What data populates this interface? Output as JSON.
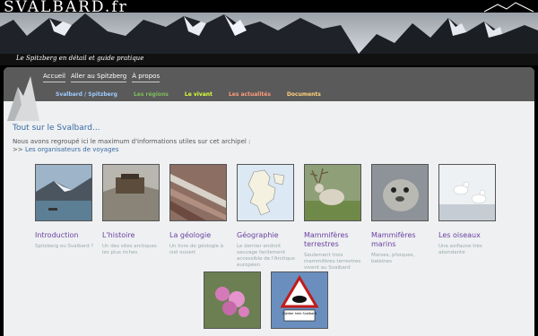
{
  "site": {
    "logo": "SVALBARD.fr",
    "tagline": "Le Spitzberg en détail et guide pratique"
  },
  "nav": {
    "top": [
      "Accueil",
      "Aller au Spitzberg",
      "À propos"
    ],
    "sub": [
      {
        "label": "Svalbard / Spitzberg",
        "color": "#9ecbff"
      },
      {
        "label": "Les régions",
        "color": "#7fbf5a"
      },
      {
        "label": "Le vivant",
        "color": "#d8ff3a"
      },
      {
        "label": "Les actualités",
        "color": "#ff9c7a"
      },
      {
        "label": "Documents",
        "color": "#ffd27a"
      }
    ]
  },
  "main": {
    "heading": "Tout sur le Svalbard...",
    "intro": "Nous avons regroupé ici le maximum d'informations utiles sur cet archipel :",
    "arrow": ">>",
    "link": "Les organisateurs de voyages"
  },
  "cards": [
    {
      "title": "Introduction",
      "desc": "Spitzberg ou Svalbard ?",
      "icon": "glacier-photo"
    },
    {
      "title": "L'histoire",
      "desc": "Un des sites arctiques les plus riches",
      "icon": "hut-photo"
    },
    {
      "title": "La géologie",
      "desc": "Un livre de géologie à ciel ouvert",
      "icon": "rock-strata-photo"
    },
    {
      "title": "Géographie",
      "desc": "Le dernier endroit sauvage facilement accessible de l'Arctique européen",
      "icon": "map"
    },
    {
      "title": "Mammifères terrestres",
      "desc": "Seulement trois mammifères terrestres vivent au Svalbard",
      "icon": "reindeer-photo"
    },
    {
      "title": "Mammifères marins",
      "desc": "Morses, phoques, baleines",
      "icon": "seal-photo"
    },
    {
      "title": "Les oiseaux",
      "desc": "Une avifaune très abondante",
      "icon": "ivory-gull-photo"
    },
    {
      "title": "",
      "desc": "",
      "icon": "flowers-photo"
    },
    {
      "title": "",
      "desc": "",
      "icon": "polar-bear-sign"
    }
  ],
  "sign_text": "Gjelder hele Svalbard"
}
